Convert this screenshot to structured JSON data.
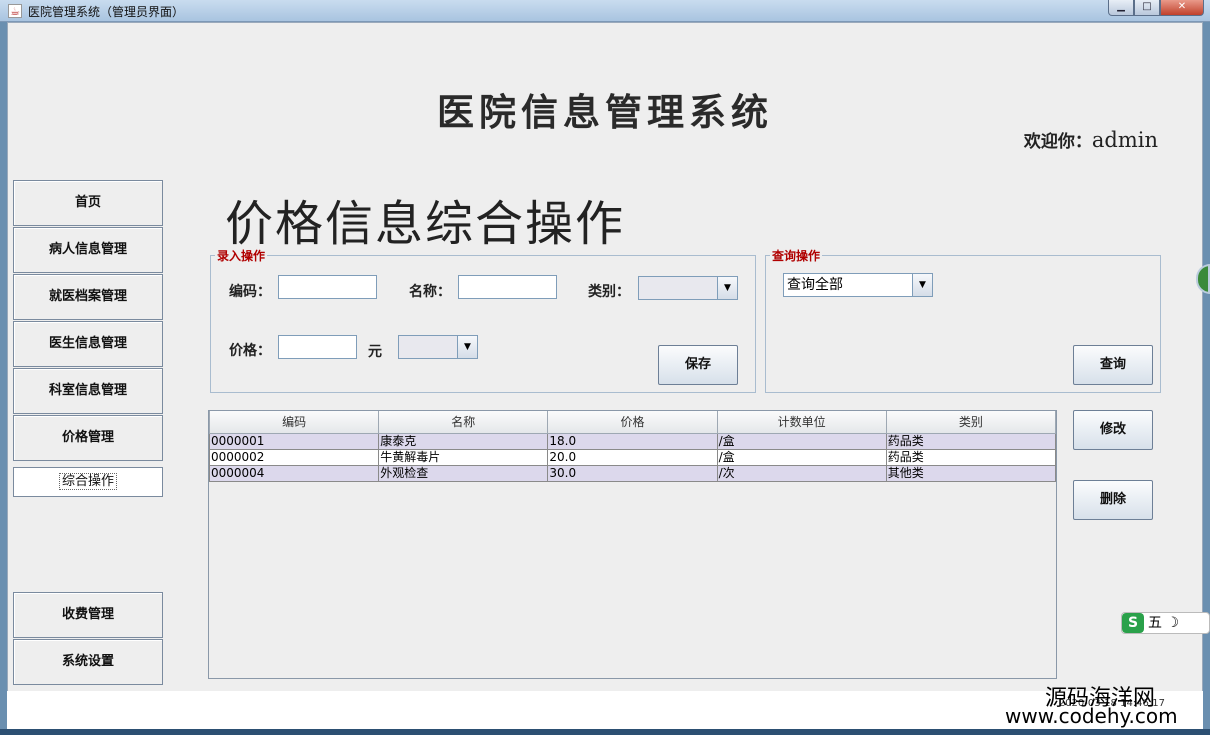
{
  "window": {
    "title": "医院管理系统（管理员界面）",
    "minimize": "▁",
    "maximize": "□",
    "close": "✕"
  },
  "header": {
    "title": "医院信息管理系统",
    "welcome_prefix": "欢迎你：",
    "username": "admin"
  },
  "sidebar": {
    "items": [
      {
        "label": "首页"
      },
      {
        "label": "病人信息管理"
      },
      {
        "label": "就医档案管理"
      },
      {
        "label": "医生信息管理"
      },
      {
        "label": "科室信息管理"
      },
      {
        "label": "价格管理"
      },
      {
        "label": "综合操作"
      },
      {
        "label": "收费管理"
      },
      {
        "label": "系统设置"
      }
    ]
  },
  "page": {
    "heading": "价格信息综合操作"
  },
  "entry": {
    "legend": "录入操作",
    "code_label": "编码：",
    "code_value": "",
    "name_label": "名称：",
    "name_value": "",
    "category_label": "类别：",
    "category_value": "",
    "price_label": "价格：",
    "price_value": "",
    "unit_suffix": "元",
    "unit_value": "",
    "save_label": "保存"
  },
  "query": {
    "legend": "查询操作",
    "selected": "查询全部",
    "query_label": "查询"
  },
  "actions": {
    "modify_label": "修改",
    "delete_label": "删除"
  },
  "table": {
    "columns": [
      "编码",
      "名称",
      "价格",
      "计数单位",
      "类别"
    ],
    "rows": [
      [
        "0000001",
        "康泰克",
        "18.0",
        "/盒",
        "药品类"
      ],
      [
        "0000002",
        "牛黄解毒片",
        "20.0",
        "/盒",
        "药品类"
      ],
      [
        "0000004",
        "外观检查",
        "30.0",
        "/次",
        "其他类"
      ]
    ]
  },
  "status": {
    "timestamp": "2020-03-18 14:46:17"
  },
  "ime": {
    "logo": "S",
    "mode": "五"
  },
  "watermark": {
    "line1": "源码海洋网",
    "line2": "www.codehy.com"
  },
  "icons": {
    "dropdown": "▼",
    "moon": "☽"
  }
}
